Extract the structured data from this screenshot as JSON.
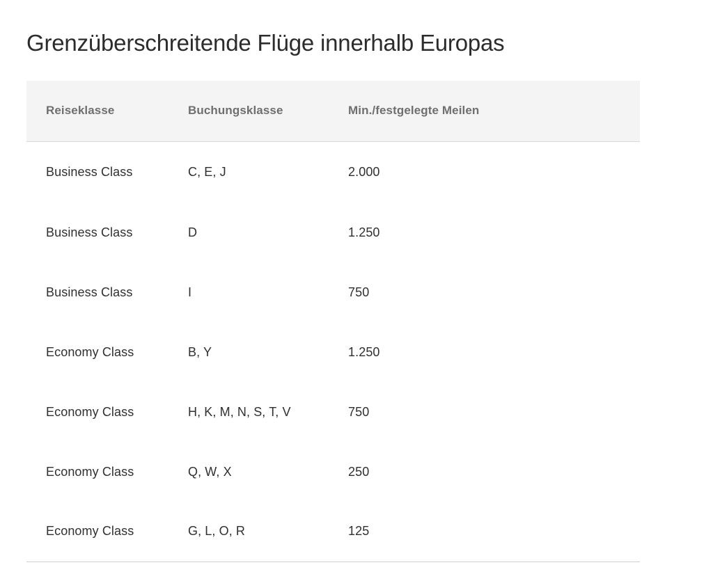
{
  "page": {
    "title": "Grenzüberschreitende Flüge innerhalb Europas",
    "background_color": "#ffffff",
    "title_color": "#2c2c2c"
  },
  "table": {
    "header_background_color": "#f4f4f4",
    "header_text_color": "#6f6f6f",
    "body_text_color": "#303030",
    "border_color": "#cfcfcf",
    "columns": [
      {
        "key": "travel_class",
        "label": "Reiseklasse"
      },
      {
        "key": "booking_class",
        "label": "Buchungsklasse"
      },
      {
        "key": "miles",
        "label": "Min./festgelegte Meilen"
      }
    ],
    "rows": [
      {
        "travel_class": "Business Class",
        "booking_class": "C, E, J",
        "miles": "2.000"
      },
      {
        "travel_class": "Business Class",
        "booking_class": "D",
        "miles": "1.250"
      },
      {
        "travel_class": "Business Class",
        "booking_class": "I",
        "miles": "750"
      },
      {
        "travel_class": "Economy Class",
        "booking_class": "B, Y",
        "miles": "1.250"
      },
      {
        "travel_class": "Economy Class",
        "booking_class": "H, K, M, N, S, T, V",
        "miles": "750"
      },
      {
        "travel_class": "Economy Class",
        "booking_class": "Q, W, X",
        "miles": "250"
      },
      {
        "travel_class": "Economy Class",
        "booking_class": "G, L, O, R",
        "miles": "125"
      }
    ]
  }
}
